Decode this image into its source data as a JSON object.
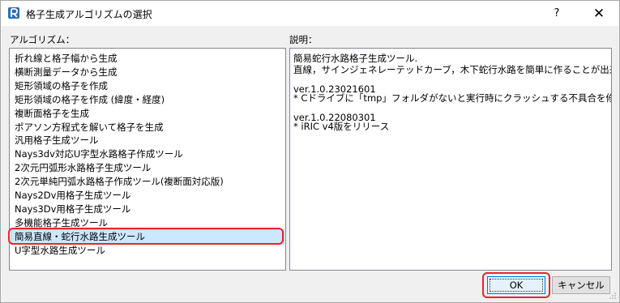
{
  "window": {
    "title": "格子生成アルゴリズムの選択",
    "help_label": "?",
    "close_label": "✕"
  },
  "algorithm": {
    "label": "アルゴリズム：",
    "items": [
      "折れ線と格子幅から生成",
      "横断測量データから生成",
      "矩形領域の格子を作成",
      "矩形領域の格子を作成 (緯度・経度)",
      "複断面格子を生成",
      "ポアソン方程式を解いて格子を生成",
      "汎用格子生成ツール",
      "Nays3dv対応U字型水路格子作成ツール",
      "2次元円弧形水路格子生成ツール",
      "2次元単純円弧水路格子作成ツール(複断面対応版)",
      "Nays2Dv用格子生成ツール",
      "Nays3Dv用格子生成ツール",
      "多機能格子生成ツール",
      "簡易直線・蛇行水路生成ツール",
      "U字型水路生成ツール"
    ],
    "selected_index": 13
  },
  "description": {
    "label": "説明：",
    "lines": [
      "簡易蛇行水路格子生成ツール.",
      "直線，サインジェネレーテッドカーブ，木下蛇行水路を簡単に作ることが出来ます.",
      "",
      "ver.1.0.23021601",
      "* Cドライブに「tmp」フォルダがないと実行時にクラッシュする不具合を修正",
      "",
      "ver.1.0.22080301",
      "* iRIC v4版をリリース"
    ]
  },
  "buttons": {
    "ok": "OK",
    "cancel": "キャンセル"
  },
  "colors": {
    "selection": "#cce8ff",
    "highlight": "#e8262b",
    "ok_border": "#0078d7"
  }
}
